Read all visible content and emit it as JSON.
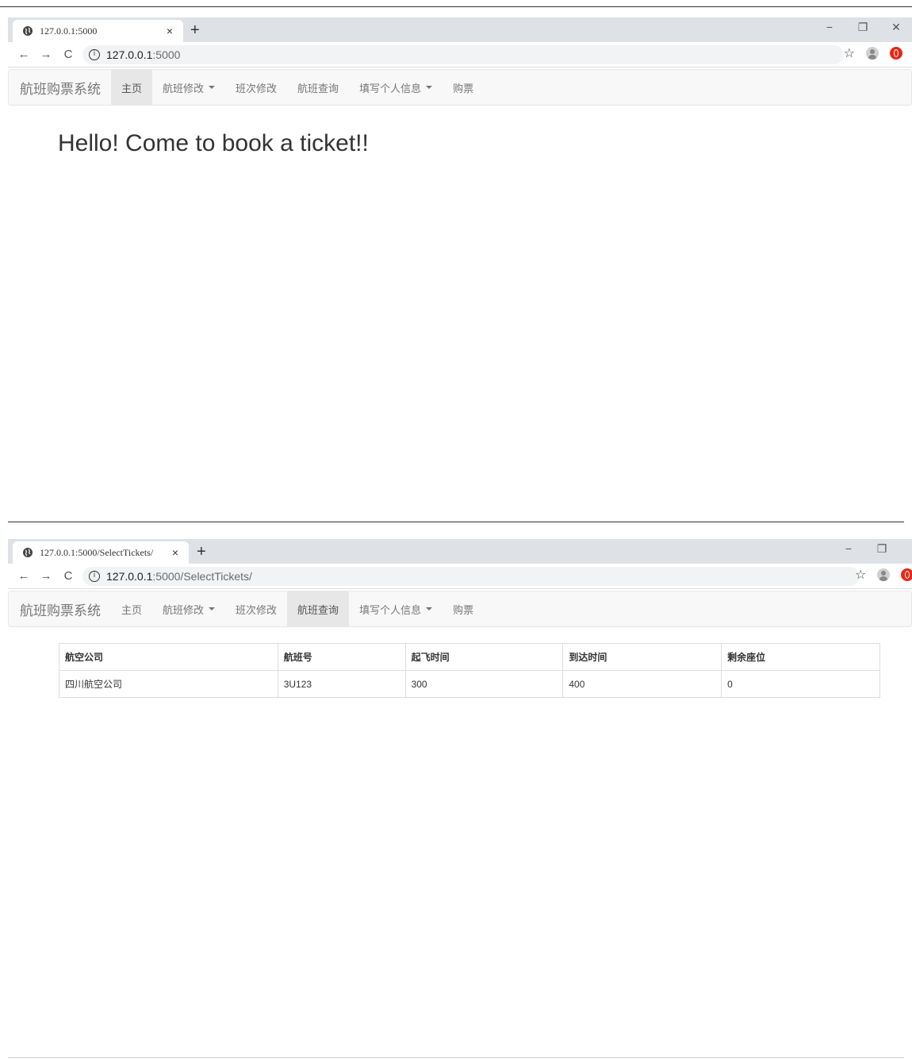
{
  "windows": [
    {
      "tab_title": "127.0.0.1:5000",
      "url_host": "127.0.0.1",
      "url_path": ":5000",
      "brand": "航班购票系统",
      "nav": [
        {
          "label": "主页"
        },
        {
          "label": "航班修改"
        },
        {
          "label": "班次修改"
        },
        {
          "label": "航班查询"
        },
        {
          "label": "填写个人信息"
        },
        {
          "label": "购票"
        }
      ],
      "heading": "Hello! Come to book a ticket!!"
    },
    {
      "tab_title": "127.0.0.1:5000/SelectTickets/",
      "url_host": "127.0.0.1",
      "url_path": ":5000/SelectTickets/",
      "brand": "航班购票系统",
      "nav": [
        {
          "label": "主页"
        },
        {
          "label": "航班修改"
        },
        {
          "label": "班次修改"
        },
        {
          "label": "航班查询"
        },
        {
          "label": "填写个人信息"
        },
        {
          "label": "购票"
        }
      ],
      "table": {
        "headers": [
          "航空公司",
          "航班号",
          "起飞时间",
          "到达时间",
          "剩余座位"
        ],
        "rows": [
          [
            "四川航空公司",
            "3U123",
            "300",
            "400",
            "0"
          ]
        ]
      }
    }
  ],
  "browser": {
    "close_glyph": "×",
    "new_tab_glyph": "+",
    "back_glyph": "←",
    "forward_glyph": "→",
    "reload_glyph": "C",
    "info_glyph": "i",
    "star_glyph": "☆",
    "minimize_glyph": "−",
    "restore_glyph": "❐",
    "window_close_glyph": "✕"
  },
  "icons": {
    "tab_favicon": "globe-icon",
    "profile": "avatar-icon",
    "extension": "opera-icon"
  },
  "colors": {
    "tabstrip": "#dee1e6",
    "navbar_bg": "#f8f8f8",
    "nav_active_bg": "#e7e7e7",
    "nav_text": "#777777",
    "opera_red": "#e62817"
  }
}
